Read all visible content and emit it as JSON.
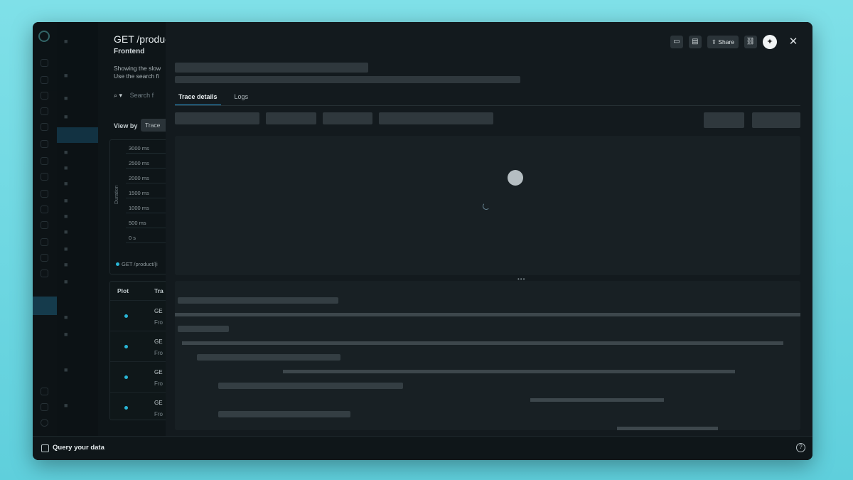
{
  "list_panel": {
    "title": "GET /product",
    "subtitle": "Frontend",
    "desc_line1": "Showing the slow",
    "desc_line2": "Use the search fi",
    "search_placeholder": "Search f",
    "view_by_label": "View by",
    "view_by_value": "Trace",
    "chart": {
      "ylabel": "Duration",
      "ticks": [
        "3000 ms",
        "2500 ms",
        "2000 ms",
        "1500 ms",
        "1000 ms",
        "500 ms",
        "0 s"
      ],
      "legend": "GET /product/{i"
    },
    "table": {
      "col_plot": "Plot",
      "col_trace": "Tra",
      "rows": [
        {
          "name": "GE",
          "sub": "Fro"
        },
        {
          "name": "GE",
          "sub": "Fro"
        },
        {
          "name": "GE",
          "sub": "Fro"
        },
        {
          "name": "GE",
          "sub": "Fro"
        }
      ]
    }
  },
  "drawer": {
    "share_label": "Share",
    "tabs": [
      "Trace details",
      "Logs"
    ],
    "close_glyph": "✕"
  },
  "footer": {
    "query_label": "Query your data",
    "help_glyph": "?"
  },
  "colors": {
    "background": "#6ad6e1",
    "accent": "#2d9bd6",
    "series": "#29b6d6"
  }
}
